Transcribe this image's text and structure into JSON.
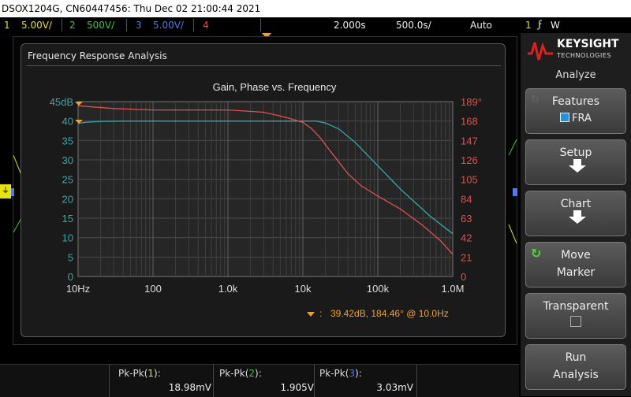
{
  "titlebar": {
    "text": "DSOX1204G, CN60447456: Thu Dec 02 21:00:44 2021"
  },
  "channels": [
    {
      "num": "1",
      "scale": "5.00V/",
      "color": "#e6e600"
    },
    {
      "num": "2",
      "scale": "500V/",
      "color": "#33cc33"
    },
    {
      "num": "3",
      "scale": "5.00V/",
      "color": "#4d79ff"
    },
    {
      "num": "4",
      "scale": "",
      "color": "#ff4040"
    }
  ],
  "timebase": {
    "position": "2.000s",
    "scale": "500.0s/",
    "mode": "Auto"
  },
  "trigger": {
    "channel": "1",
    "slope": "W"
  },
  "fra": {
    "window_title": "Frequency Response Analysis",
    "cursor_readout": "39.42dB, 184.46° @ 10.0Hz"
  },
  "chart_data": {
    "type": "line",
    "title": "Gain, Phase vs. Frequency",
    "xlabel": "",
    "ylabel": "",
    "x_scale": "log",
    "x_ticks": [
      "10Hz",
      "100",
      "1.0k",
      "10k",
      "100k",
      "1.0M"
    ],
    "x_tick_values": [
      10,
      100,
      1000,
      10000,
      100000,
      1000000
    ],
    "y_left_ticks": [
      "45dB",
      "40",
      "35",
      "30",
      "25",
      "20",
      "15",
      "10",
      "5",
      "0"
    ],
    "y_left_range": [
      0,
      45
    ],
    "y_right_ticks": [
      "189°",
      "168",
      "147",
      "126",
      "105",
      "84",
      "63",
      "42",
      "21",
      "0"
    ],
    "y_right_range": [
      0,
      189
    ],
    "grid": true,
    "series": [
      {
        "name": "",
        "axis": "left",
        "color": "#3aa6a6",
        "x": [
          10,
          13,
          20,
          50,
          100,
          1000,
          10000,
          15000,
          20000,
          30000,
          50000,
          100000,
          200000,
          500000,
          1000000
        ],
        "values": [
          39.4,
          39.7,
          39.9,
          40.0,
          40.0,
          40.0,
          40.0,
          40.0,
          39.5,
          38.0,
          34.5,
          28.5,
          22.5,
          15.5,
          11.0
        ]
      },
      {
        "name": "",
        "axis": "right",
        "color": "#e05050",
        "x": [
          10,
          30,
          100,
          1000,
          3000,
          5000,
          8000,
          10000,
          13000,
          17000,
          22000,
          30000,
          40000,
          60000,
          100000,
          200000,
          400000,
          700000,
          1000000
        ],
        "values": [
          184.5,
          181.5,
          180.0,
          180.0,
          177.5,
          173.5,
          169.0,
          166.5,
          160.0,
          150.0,
          138.0,
          124.0,
          111.0,
          98.0,
          87.0,
          73.0,
          55.0,
          38.0,
          24.0
        ]
      }
    ]
  },
  "measurements": [
    {
      "label": "Pk-Pk(",
      "ch": "1",
      "close": "):",
      "value": "18.98mV",
      "color": "#e6e600"
    },
    {
      "label": "Pk-Pk(",
      "ch": "2",
      "close": "):",
      "value": "1.905V",
      "color": "#33cc33"
    },
    {
      "label": "Pk-Pk(",
      "ch": "3",
      "close": "):",
      "value": "3.03mV",
      "color": "#4d79ff"
    }
  ],
  "panel": {
    "brand": "KEYSIGHT",
    "brand_sub": "TECHNOLOGIES",
    "menu_title": "Analyze",
    "features": {
      "label": "Features",
      "value": "FRA"
    },
    "setup": {
      "label": "Setup"
    },
    "chart": {
      "label": "Chart"
    },
    "move_marker": {
      "line1": "Move",
      "line2": "Marker"
    },
    "transparent": {
      "label": "Transparent"
    },
    "run_analysis": {
      "line1": "Run",
      "line2": "Analysis"
    }
  }
}
